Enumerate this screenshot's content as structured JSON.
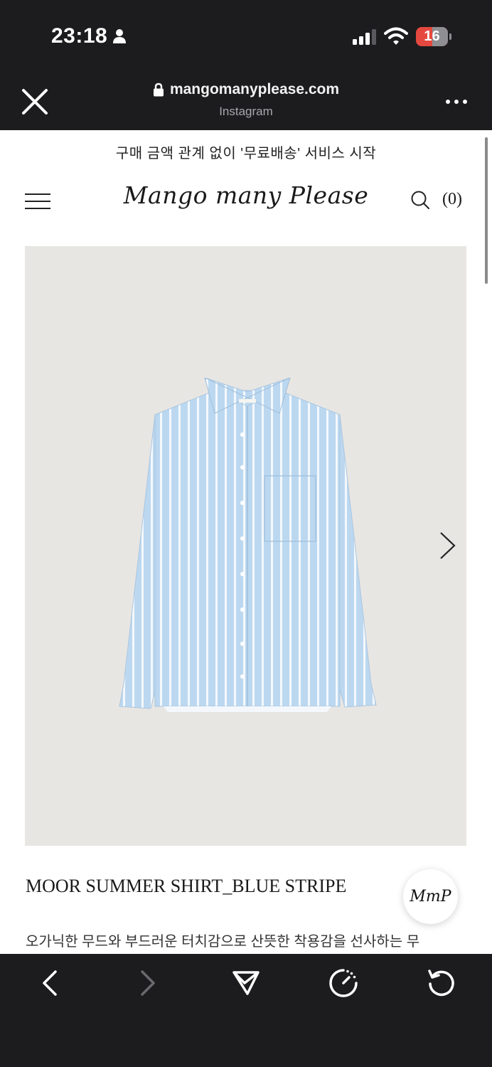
{
  "status_bar": {
    "time": "23:18",
    "battery_level": "16",
    "icons": [
      "person-icon",
      "signal-icon",
      "wifi-icon",
      "battery-icon"
    ]
  },
  "browser": {
    "url": "mangomanyplease.com",
    "source": "Instagram",
    "icons": [
      "close-icon",
      "lock-icon",
      "more-icon"
    ]
  },
  "site": {
    "notice": "구매 금액 관계 없이 '무료배송' 서비스 시작",
    "logo": "Mango many Please",
    "cart_count": "(0)",
    "icons": [
      "menu-icon",
      "search-icon"
    ]
  },
  "product": {
    "image_icons": [
      "chevron-right-icon"
    ],
    "name": "MOOR SUMMER SHIRT_BLUE STRIPE",
    "description": "오가닉한 무드와 부드러운 터치감으로 산뜻한 착용감을 선사하는 무",
    "badge": "MmP"
  },
  "bottom_bar": {
    "icons": [
      "back-icon",
      "forward-icon",
      "share-icon",
      "speed-icon",
      "refresh-icon"
    ]
  },
  "colors": {
    "chrome": "#1c1c1e",
    "battery_low": "#e5483f",
    "image_bg": "#e8e6e3",
    "shirt_blue": "#bcd8f0"
  }
}
